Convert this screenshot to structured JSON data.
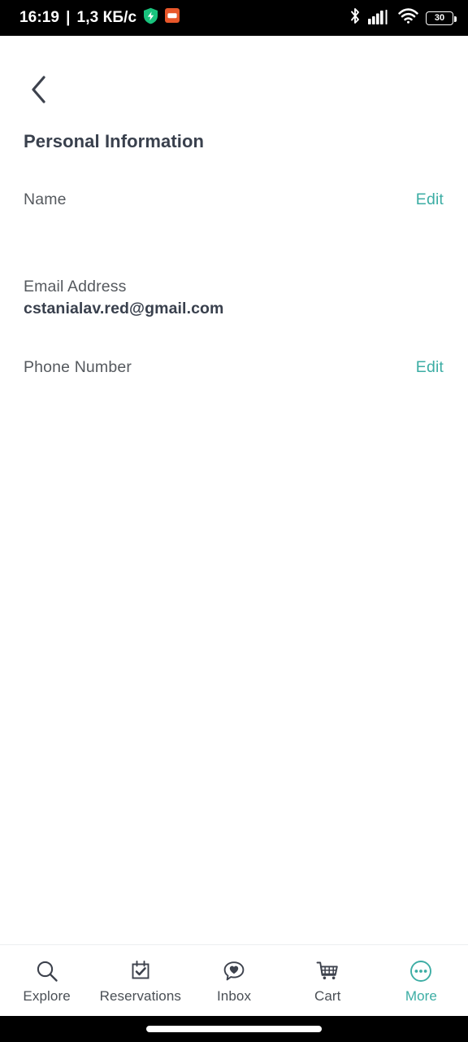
{
  "status_bar": {
    "clock": "16:19",
    "separator": "|",
    "network_speed": "1,3 КБ/с",
    "icons": [
      "shield-icon",
      "app-square-icon",
      "bluetooth-icon",
      "cellular-signal-icon",
      "wifi-icon",
      "battery-icon"
    ],
    "battery_level": "30",
    "background_color": "#000000",
    "text_color": "#ffffff"
  },
  "header": {
    "back_icon": "chevron-left-icon",
    "title": "Personal Information"
  },
  "colors": {
    "accent_teal": "#3cada4",
    "title_dark": "#39404d",
    "label_gray": "#55595e",
    "page_background": "#ffffff"
  },
  "rows": [
    {
      "label": "Name",
      "value": "",
      "action": "Edit",
      "has_action": true
    },
    {
      "label": "Email Address",
      "value": "cstanialav.red@gmail.com",
      "action": "",
      "has_action": false
    },
    {
      "label": "Phone Number",
      "value": "",
      "action": "Edit",
      "has_action": true
    }
  ],
  "tabbar": {
    "items": [
      {
        "label": "Explore",
        "icon": "search-icon",
        "active": false
      },
      {
        "label": "Reservations",
        "icon": "calendar-check-icon",
        "active": false
      },
      {
        "label": "Inbox",
        "icon": "chat-heart-icon",
        "active": false
      },
      {
        "label": "Cart",
        "icon": "shopping-cart-icon",
        "active": false
      },
      {
        "label": "More",
        "icon": "more-circle-icon",
        "active": true
      }
    ]
  },
  "gesture_bar": {
    "indicator": "home-gesture-pill"
  }
}
